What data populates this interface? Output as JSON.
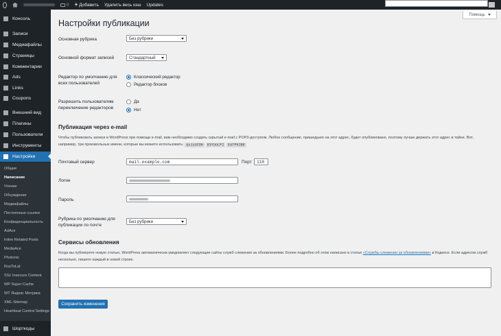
{
  "adminbar": {
    "comments_count": "0",
    "new_label": "Добавить",
    "clear_cache_label": "Удалить весь кэш",
    "updates_label": "Updates"
  },
  "menu": {
    "items": [
      {
        "label": "Консоль",
        "icon": "dashboard-icon"
      },
      {
        "label": "Записи",
        "icon": "pin-icon"
      },
      {
        "label": "Медиафайлы",
        "icon": "media-icon"
      },
      {
        "label": "Страницы",
        "icon": "page-icon"
      },
      {
        "label": "Комментарии",
        "icon": "comment-icon"
      },
      {
        "label": "Ads",
        "icon": "ads-icon"
      },
      {
        "label": "Links",
        "icon": "links-icon"
      },
      {
        "label": "Coupons",
        "icon": "coupons-icon"
      },
      {
        "label": "Внешний вид",
        "icon": "brush-icon"
      },
      {
        "label": "Плагины",
        "icon": "plugin-icon"
      },
      {
        "label": "Пользователи",
        "icon": "users-icon"
      },
      {
        "label": "Инструменты",
        "icon": "wrench-icon"
      },
      {
        "label": "Настройки",
        "icon": "settings-icon"
      }
    ],
    "bottom_item": {
      "label": "Шорткоды",
      "icon": "shortcodes-icon"
    },
    "submenu": [
      "Общие",
      "Написание",
      "Чтение",
      "Обсуждение",
      "Медиафайлы",
      "Постоянные ссылки",
      "Конфиденциальность",
      "AdAce",
      "Inline Related Posts",
      "MediaAce",
      "Photonix",
      "RusToLat",
      "SSL Insecure Content",
      "WP Super Cache",
      "WT Яндекс Метрика",
      "XML-Sitemap",
      "Heartbeat Control Settings"
    ]
  },
  "help_tab": "Помощь",
  "page_title": "Настройки публикации",
  "default_category": {
    "label": "Основная рубрика",
    "value": "Без рубрики"
  },
  "default_format": {
    "label": "Основной формат записей",
    "value": "Стандартный"
  },
  "default_editor": {
    "label": "Редактор по умолчанию для всех пользователей",
    "options": [
      "Классический редактор",
      "Редактор блоков"
    ],
    "selected": 0
  },
  "allow_switch": {
    "label": "Разрешить пользователям переключение редакторов",
    "options": [
      "Да",
      "Нет"
    ],
    "selected": 1
  },
  "email_section": {
    "title": "Публикация через e-mail",
    "desc": "Чтобы публиковать записи в WordPress при помощи e-mail, вам необходимо создать скрытый e-mail с POP3-доступом. Любое сообщение, пришедшее на этот адрес, будет опубликовано, поэтому лучше держать этот адрес в тайне. Вот, например, три произвольных имени, которые вы можете использовать:",
    "codes": [
      "qxJyUCOH",
      "83YUocF2",
      "EATPKIBE"
    ],
    "mail_server": {
      "label": "Почтовый сервер",
      "value": "mail.example.com"
    },
    "port": {
      "label": "Порт",
      "value": "110"
    },
    "login": {
      "label": "Логин"
    },
    "password": {
      "label": "Пароль"
    },
    "mail_category": {
      "label": "Рубрика по умолчанию для публикации по почте",
      "value": "Без рубрики"
    }
  },
  "update_services": {
    "title": "Сервисы обновления",
    "desc_before": "Когда вы публикуете новую статью, WordPress автоматически уведомляет следующие сайты служб слежения за обновлениями. Более подробно об этом написано в статье ",
    "link": "«Службы слежения за обновлениями»",
    "desc_after": " в Кодексе. Если адресов служб несколько, пишите каждый в новой строке."
  },
  "save_button": "Сохранить изменения"
}
